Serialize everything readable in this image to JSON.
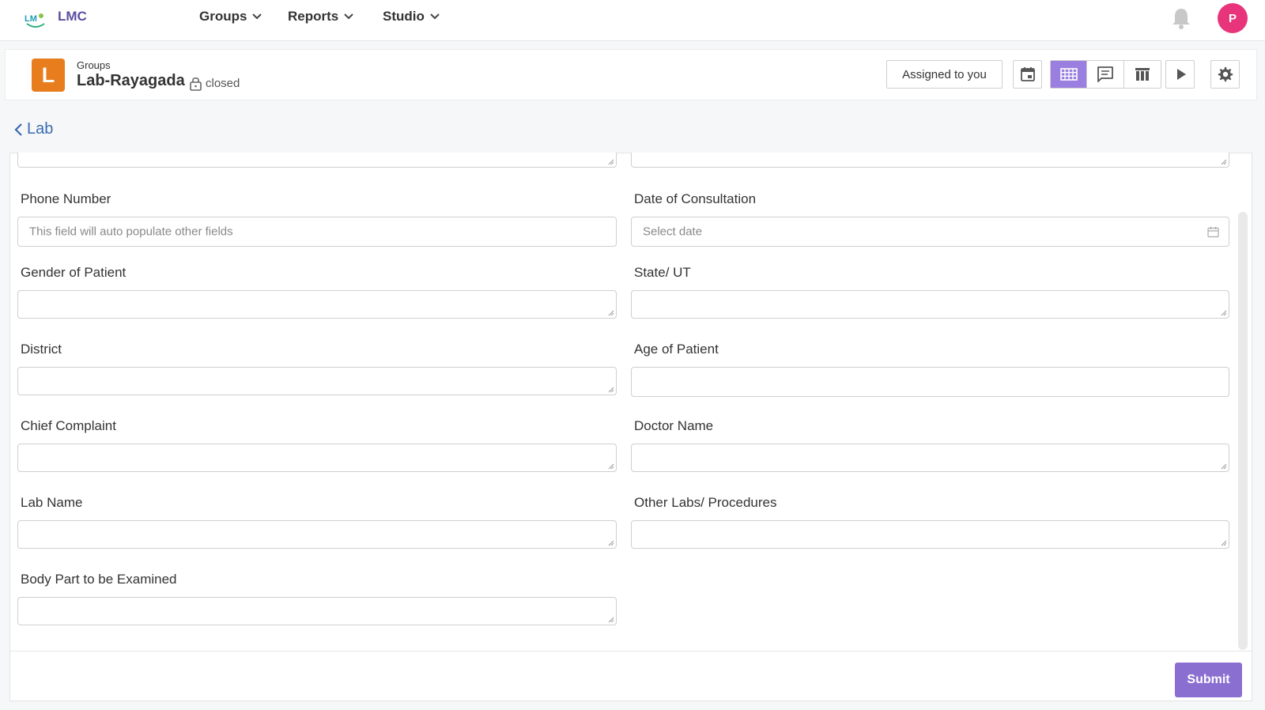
{
  "app": {
    "name": "LMC"
  },
  "nav": {
    "menus": [
      {
        "label": "Groups"
      },
      {
        "label": "Reports"
      },
      {
        "label": "Studio"
      }
    ],
    "avatar_initial": "P"
  },
  "header": {
    "group_initial": "L",
    "breadcrumb": "Groups",
    "title": "Lab-Rayagada",
    "status": "closed",
    "assigned_label": "Assigned to you",
    "active_view": "table-view"
  },
  "back": {
    "label": "Lab"
  },
  "form": {
    "fields": [
      {
        "label": "Phone Number",
        "placeholder": "This field will auto populate other fields",
        "type": "text",
        "value": ""
      },
      {
        "label": "Date of Consultation",
        "placeholder": "Select date",
        "type": "date",
        "value": ""
      },
      {
        "label": "Gender of Patient",
        "placeholder": "",
        "type": "textarea",
        "value": ""
      },
      {
        "label": "State/ UT",
        "placeholder": "",
        "type": "textarea",
        "value": ""
      },
      {
        "label": "District",
        "placeholder": "",
        "type": "textarea",
        "value": ""
      },
      {
        "label": "Age of Patient",
        "placeholder": "",
        "type": "text",
        "value": ""
      },
      {
        "label": "Chief Complaint",
        "placeholder": "",
        "type": "textarea",
        "value": ""
      },
      {
        "label": "Doctor Name",
        "placeholder": "",
        "type": "textarea",
        "value": ""
      },
      {
        "label": "Lab Name",
        "placeholder": "",
        "type": "textarea",
        "value": ""
      },
      {
        "label": "Other Labs/ Procedures",
        "placeholder": "",
        "type": "textarea",
        "value": ""
      },
      {
        "label": "Body Part to be Examined",
        "placeholder": "",
        "type": "textarea",
        "value": ""
      }
    ],
    "submit_label": "Submit"
  },
  "colors": {
    "accent": "#8a6fd1",
    "active_view": "#9b7fe0",
    "avatar": "#e8347b",
    "group_icon": "#e87d1e",
    "link": "#3b6bb3"
  }
}
